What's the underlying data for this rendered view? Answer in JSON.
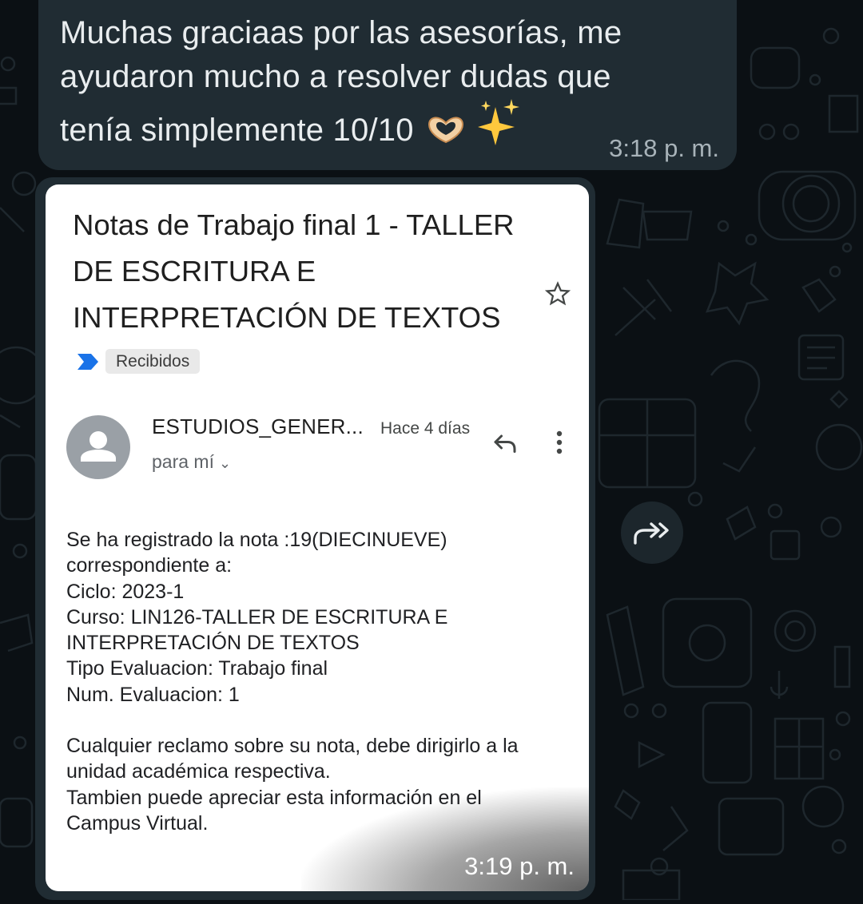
{
  "messages": {
    "text_message": {
      "text": "Muchas graciaas por las asesorías, me ayudaron mucho a resolver dudas que tenía simplemente 10/10",
      "emoji": [
        "heart-hands-emoji",
        "sparkles-emoji"
      ],
      "time": "3:18 p. m."
    },
    "image_message": {
      "time": "3:19 p. m."
    }
  },
  "email": {
    "subject": "Notas de Trabajo final 1 - TALLER DE ESCRITURA E INTERPRETACIÓN DE TEXTOS",
    "label": "Recibidos",
    "sender": "ESTUDIOS_GENER...",
    "received": "Hace 4 días",
    "recipient": "para mí",
    "body": {
      "line1": "Se ha registrado la nota :19(DIECINUEVE)",
      "line2": "correspondiente a:",
      "line3": "Ciclo: 2023-1",
      "line4": "Curso: LIN126-TALLER DE ESCRITURA E",
      "line5": "INTERPRETACIÓN DE TEXTOS",
      "line6": "Tipo Evaluacion: Trabajo final",
      "line7": "Num. Evaluacion: 1",
      "line8": "Cualquier reclamo sobre su nota, debe dirigirlo a la",
      "line9": "unidad académica respectiva.",
      "line10": "Tambien puede apreciar esta información en el",
      "line11": "Campus Virtual."
    }
  },
  "icons": [
    "star-icon",
    "label-arrow-icon",
    "avatar-person-icon",
    "reply-icon",
    "more-vert-icon",
    "forward-icon"
  ],
  "colors": {
    "chat_background": "#0b1014",
    "bubble": "#202c33",
    "text": "#e9edef",
    "timestamp": "#a8b3b9",
    "label_arrow": "#1a73e8"
  }
}
